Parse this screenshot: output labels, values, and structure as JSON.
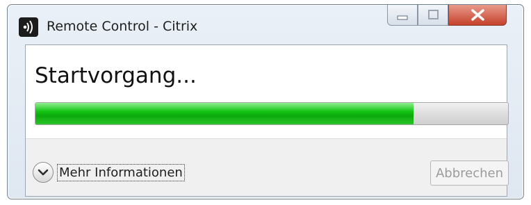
{
  "window": {
    "title": "Remote Control - Citrix",
    "controls": {
      "minimize": "minimize-icon",
      "maximize": "maximize-icon",
      "close": "close-icon"
    }
  },
  "main": {
    "heading": "Startvorgang...",
    "progress_percent": 80
  },
  "footer": {
    "more_info_label": "Mehr Informationen",
    "more_info_icon": "chevron-down-icon",
    "cancel_label": "Abbrechen",
    "cancel_enabled": false
  },
  "colors": {
    "progress_green": "#14c414",
    "close_red": "#c4412b"
  }
}
